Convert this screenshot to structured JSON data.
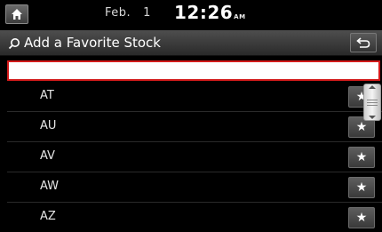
{
  "status": {
    "month": "Feb.",
    "day": "1",
    "time": "12:26",
    "ampm": "AM"
  },
  "header": {
    "title": "Add a Favorite Stock",
    "search_icon": "search-icon",
    "back_icon": "back-arrow-icon",
    "home_icon": "home-icon"
  },
  "search": {
    "value": "",
    "placeholder": ""
  },
  "list": {
    "items": [
      {
        "label": "AT",
        "icon": "star-icon",
        "star": "★"
      },
      {
        "label": "AU",
        "icon": "star-icon",
        "star": "★"
      },
      {
        "label": "AV",
        "icon": "star-icon",
        "star": "★"
      },
      {
        "label": "AW",
        "icon": "star-icon",
        "star": "★"
      },
      {
        "label": "AZ",
        "icon": "star-icon",
        "star": "★"
      }
    ]
  },
  "colors": {
    "background": "#000000",
    "input_border": "#d21a1a",
    "title_bar": "#3c3c3c"
  }
}
